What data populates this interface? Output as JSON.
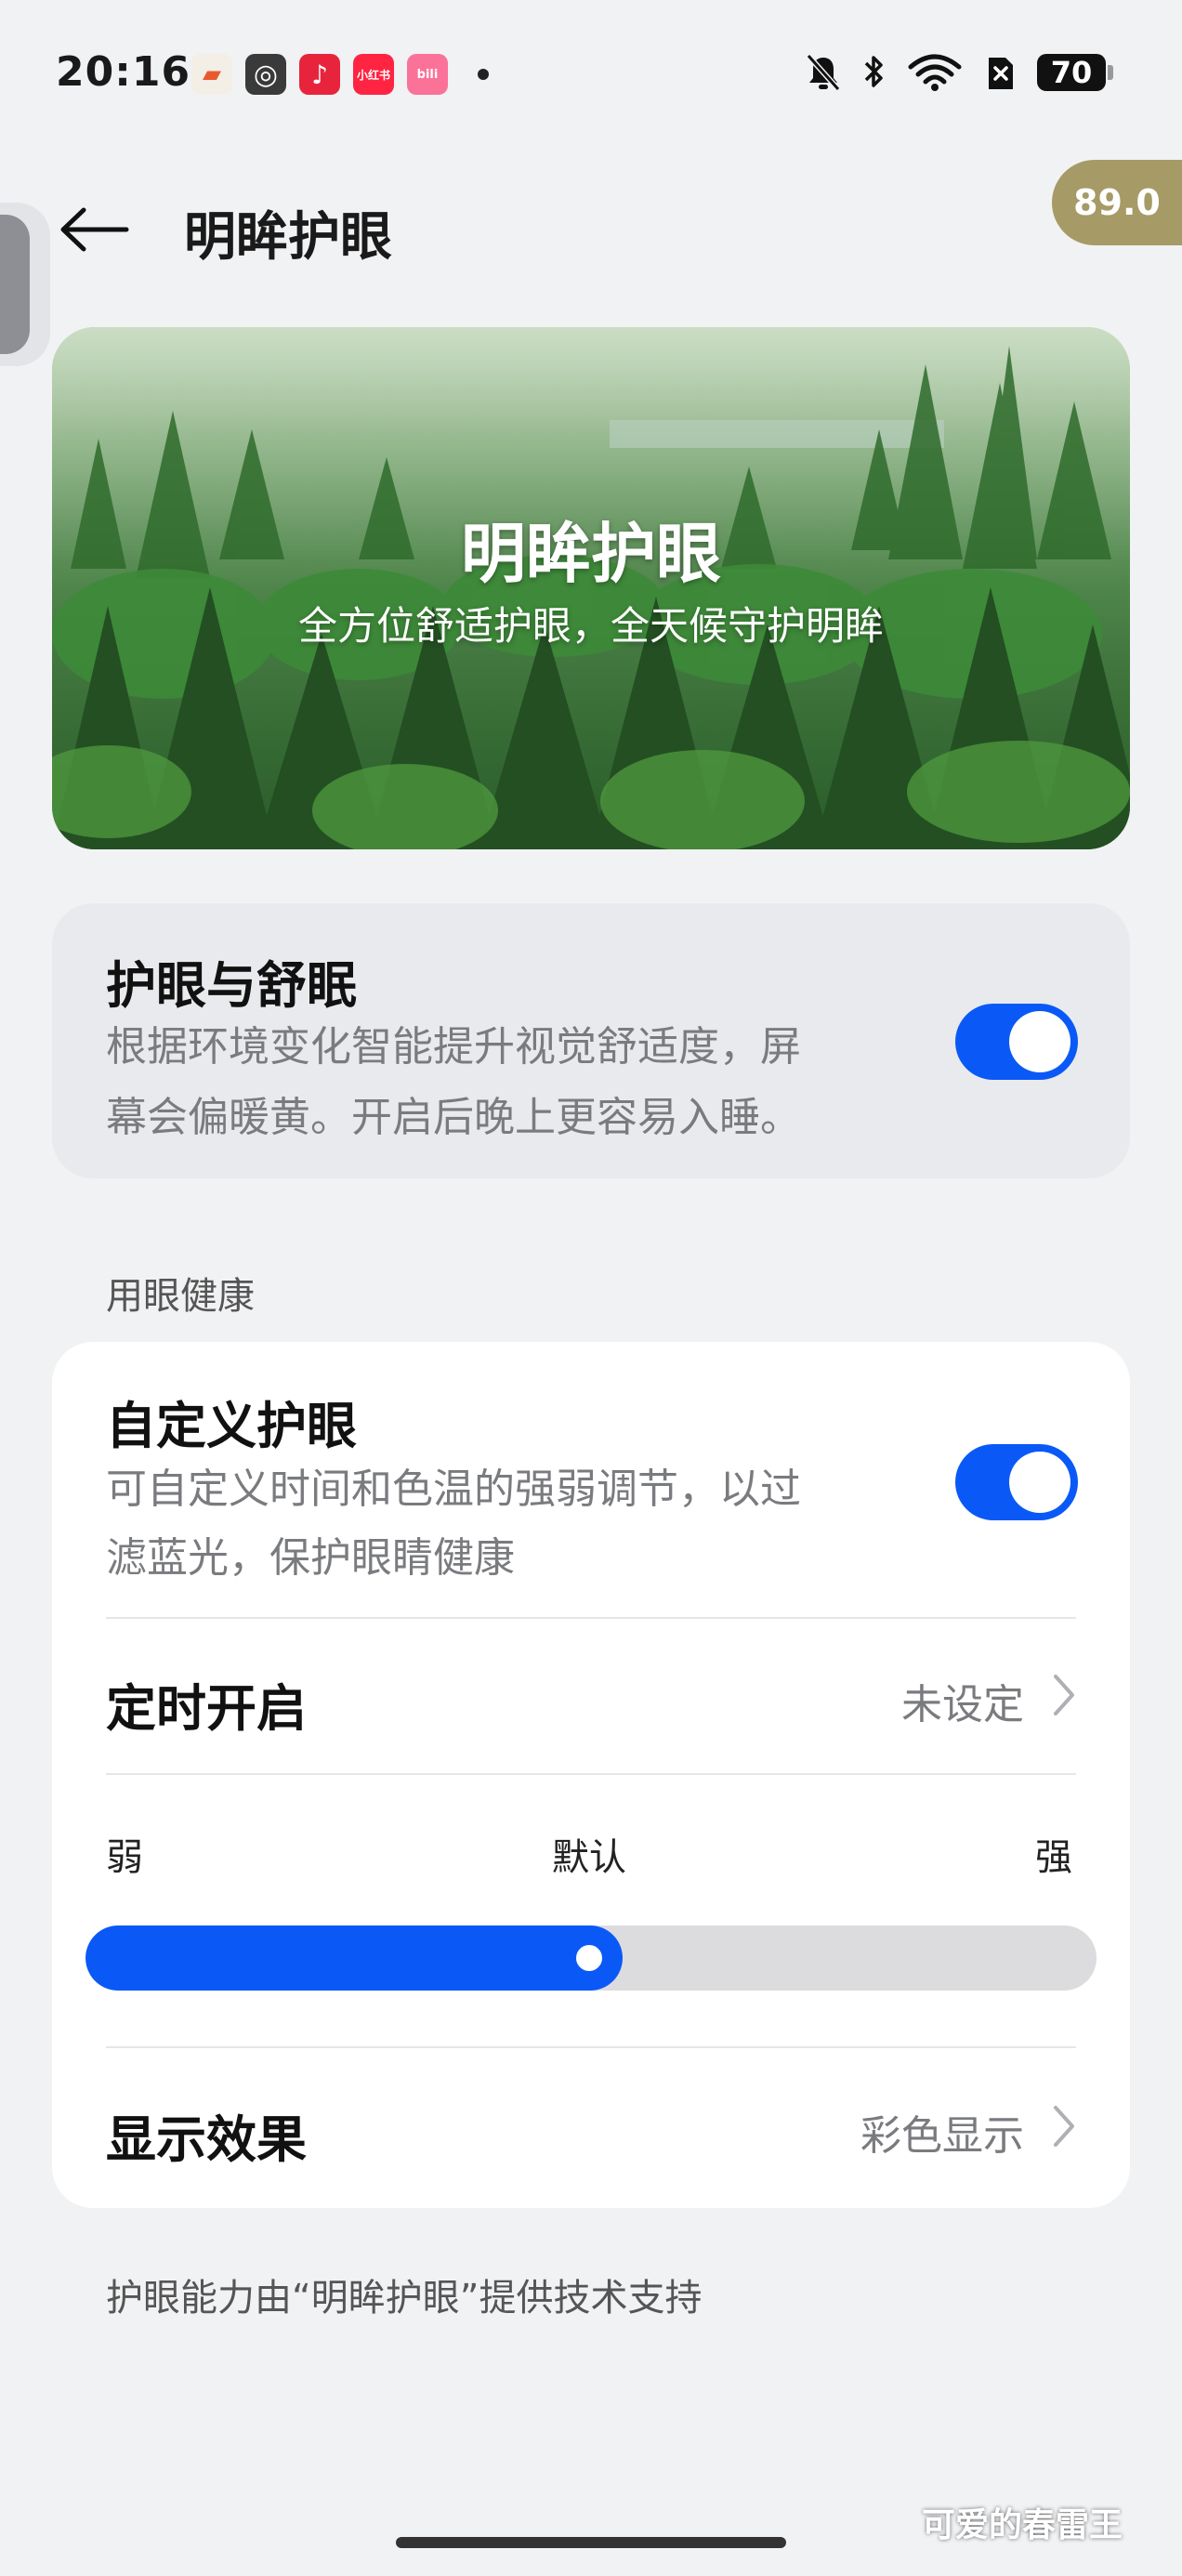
{
  "status_bar": {
    "time": "20:16",
    "app_icons": [
      {
        "name": "game-app-icon",
        "color": "#e85a2e",
        "glyph": "🎮"
      },
      {
        "name": "spiral-app-icon",
        "color": "#444444",
        "glyph": "◎"
      },
      {
        "name": "music-app-icon",
        "color": "#e8243c",
        "glyph": "♪"
      },
      {
        "name": "xiaohongshu-app-icon",
        "color": "#ff2442",
        "glyph": "小红书"
      },
      {
        "name": "bilibili-app-icon",
        "color": "#fb7299",
        "glyph": "bili"
      }
    ],
    "battery": "70"
  },
  "header": {
    "title": "明眸护眼",
    "float_badge": "89.0"
  },
  "banner": {
    "title": "明眸护眼",
    "subtitle": "全方位舒适护眼，全天候守护明眸"
  },
  "eye_sleep": {
    "title": "护眼与舒眠",
    "desc_line1": "根据环境变化智能提升视觉舒适度，屏",
    "desc_line2": "幕会偏暖黄。开启后晚上更容易入睡。",
    "enabled": true
  },
  "section_label": "用眼健康",
  "custom_eye": {
    "title": "自定义护眼",
    "desc_line1": "可自定义时间和色温的强弱调节，以过",
    "desc_line2": "滤蓝光，保护眼睛健康",
    "enabled": true
  },
  "schedule": {
    "label": "定时开启",
    "value": "未设定"
  },
  "intensity": {
    "weak": "弱",
    "default": "默认",
    "strong": "强",
    "level": 0.5
  },
  "display_effect": {
    "label": "显示效果",
    "value": "彩色显示"
  },
  "footer_note": "护眼能力由“明眸护眼”提供技术支持",
  "watermark": "可爱的春雷王",
  "colors": {
    "accent": "#0a59f7",
    "badge": "#a69a66"
  }
}
